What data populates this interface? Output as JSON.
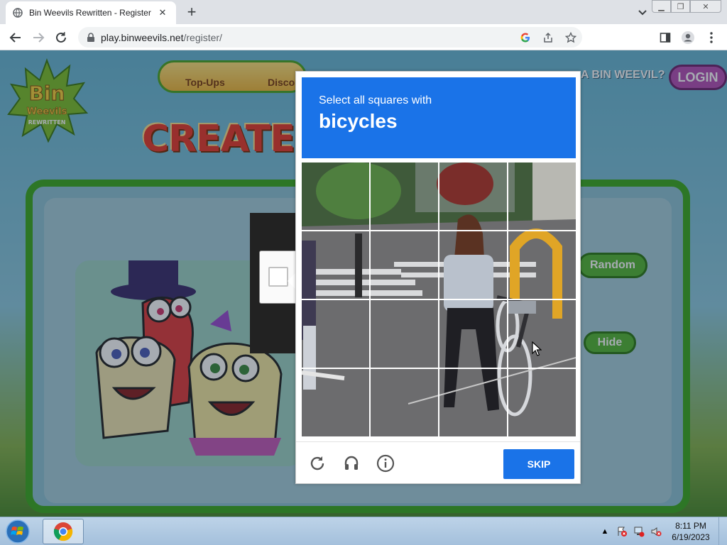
{
  "browser": {
    "tab_title": "Bin Weevils Rewritten - Register",
    "url_host": "play.binweevils.net",
    "url_path": "/register/"
  },
  "page": {
    "nav_items": [
      "Top-Ups",
      "Discor"
    ],
    "headline": "CREATE Y",
    "weevil_question": "A BIN WEEVIL?",
    "login_label": "LOGIN",
    "random_label": "Random",
    "hide_label": "Hide",
    "logo_text": [
      "Bin",
      "Weevils",
      "REWRITTEN"
    ]
  },
  "captcha": {
    "instruction": "Select all squares with",
    "object": "bicycles",
    "skip_label": "SKIP"
  },
  "taskbar": {
    "time": "8:11 PM",
    "date": "6/19/2023"
  },
  "colors": {
    "captcha_blue": "#1a73e8",
    "panel_green": "#3daa1f"
  }
}
